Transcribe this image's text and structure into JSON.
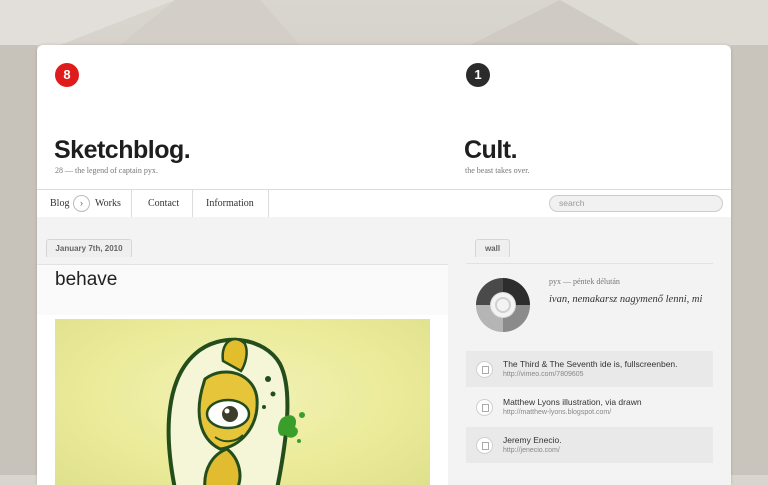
{
  "left_site": {
    "badge": "8",
    "title": "Sketchblog.",
    "subtitle": "28 — the legend of captain pyx."
  },
  "right_site": {
    "badge": "1",
    "title": "Cult.",
    "subtitle": "the beast takes over."
  },
  "nav": {
    "items": [
      "Blog",
      "Works",
      "Contact",
      "Information"
    ],
    "arrow": "›",
    "search_placeholder": "search"
  },
  "post": {
    "date": "January 7th, 2010",
    "title": "behave"
  },
  "wall": {
    "tab": "wall",
    "meta": "pyx — péntek délután",
    "quote": "ivan, nemakarsz nagymenő lenni, mi",
    "links": [
      {
        "title": "The Third & The Seventh ide is, fullscreenben.",
        "url": "http://vimeo.com/7809605"
      },
      {
        "title": "Matthew Lyons illustration, via drawn",
        "url": "http://matthew-lyons.blogspot.com/"
      },
      {
        "title": "Jeremy Enecio.",
        "url": "http://jenecio.com/"
      }
    ]
  },
  "colors": {
    "accent_red": "#e01b1b",
    "dark_badge": "#2b2b2b",
    "illustration_bg": "#ebeb9a"
  }
}
